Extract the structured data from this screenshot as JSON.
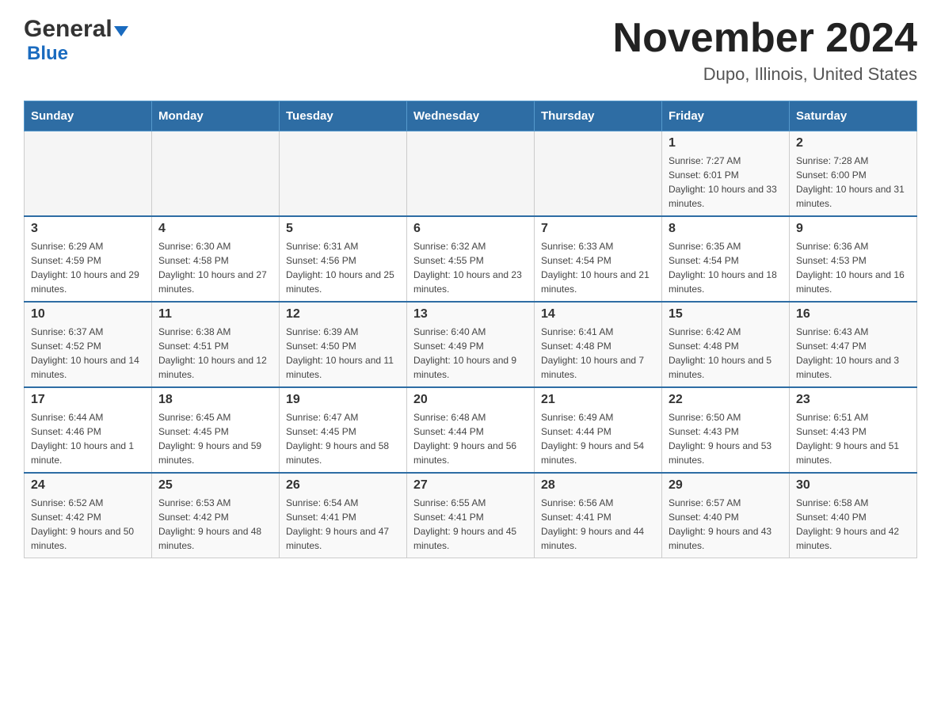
{
  "header": {
    "logo_general": "General",
    "logo_blue": "Blue",
    "title": "November 2024",
    "subtitle": "Dupo, Illinois, United States"
  },
  "days_of_week": [
    "Sunday",
    "Monday",
    "Tuesday",
    "Wednesday",
    "Thursday",
    "Friday",
    "Saturday"
  ],
  "weeks": [
    [
      {
        "day": "",
        "sunrise": "",
        "sunset": "",
        "daylight": ""
      },
      {
        "day": "",
        "sunrise": "",
        "sunset": "",
        "daylight": ""
      },
      {
        "day": "",
        "sunrise": "",
        "sunset": "",
        "daylight": ""
      },
      {
        "day": "",
        "sunrise": "",
        "sunset": "",
        "daylight": ""
      },
      {
        "day": "",
        "sunrise": "",
        "sunset": "",
        "daylight": ""
      },
      {
        "day": "1",
        "sunrise": "Sunrise: 7:27 AM",
        "sunset": "Sunset: 6:01 PM",
        "daylight": "Daylight: 10 hours and 33 minutes."
      },
      {
        "day": "2",
        "sunrise": "Sunrise: 7:28 AM",
        "sunset": "Sunset: 6:00 PM",
        "daylight": "Daylight: 10 hours and 31 minutes."
      }
    ],
    [
      {
        "day": "3",
        "sunrise": "Sunrise: 6:29 AM",
        "sunset": "Sunset: 4:59 PM",
        "daylight": "Daylight: 10 hours and 29 minutes."
      },
      {
        "day": "4",
        "sunrise": "Sunrise: 6:30 AM",
        "sunset": "Sunset: 4:58 PM",
        "daylight": "Daylight: 10 hours and 27 minutes."
      },
      {
        "day": "5",
        "sunrise": "Sunrise: 6:31 AM",
        "sunset": "Sunset: 4:56 PM",
        "daylight": "Daylight: 10 hours and 25 minutes."
      },
      {
        "day": "6",
        "sunrise": "Sunrise: 6:32 AM",
        "sunset": "Sunset: 4:55 PM",
        "daylight": "Daylight: 10 hours and 23 minutes."
      },
      {
        "day": "7",
        "sunrise": "Sunrise: 6:33 AM",
        "sunset": "Sunset: 4:54 PM",
        "daylight": "Daylight: 10 hours and 21 minutes."
      },
      {
        "day": "8",
        "sunrise": "Sunrise: 6:35 AM",
        "sunset": "Sunset: 4:54 PM",
        "daylight": "Daylight: 10 hours and 18 minutes."
      },
      {
        "day": "9",
        "sunrise": "Sunrise: 6:36 AM",
        "sunset": "Sunset: 4:53 PM",
        "daylight": "Daylight: 10 hours and 16 minutes."
      }
    ],
    [
      {
        "day": "10",
        "sunrise": "Sunrise: 6:37 AM",
        "sunset": "Sunset: 4:52 PM",
        "daylight": "Daylight: 10 hours and 14 minutes."
      },
      {
        "day": "11",
        "sunrise": "Sunrise: 6:38 AM",
        "sunset": "Sunset: 4:51 PM",
        "daylight": "Daylight: 10 hours and 12 minutes."
      },
      {
        "day": "12",
        "sunrise": "Sunrise: 6:39 AM",
        "sunset": "Sunset: 4:50 PM",
        "daylight": "Daylight: 10 hours and 11 minutes."
      },
      {
        "day": "13",
        "sunrise": "Sunrise: 6:40 AM",
        "sunset": "Sunset: 4:49 PM",
        "daylight": "Daylight: 10 hours and 9 minutes."
      },
      {
        "day": "14",
        "sunrise": "Sunrise: 6:41 AM",
        "sunset": "Sunset: 4:48 PM",
        "daylight": "Daylight: 10 hours and 7 minutes."
      },
      {
        "day": "15",
        "sunrise": "Sunrise: 6:42 AM",
        "sunset": "Sunset: 4:48 PM",
        "daylight": "Daylight: 10 hours and 5 minutes."
      },
      {
        "day": "16",
        "sunrise": "Sunrise: 6:43 AM",
        "sunset": "Sunset: 4:47 PM",
        "daylight": "Daylight: 10 hours and 3 minutes."
      }
    ],
    [
      {
        "day": "17",
        "sunrise": "Sunrise: 6:44 AM",
        "sunset": "Sunset: 4:46 PM",
        "daylight": "Daylight: 10 hours and 1 minute."
      },
      {
        "day": "18",
        "sunrise": "Sunrise: 6:45 AM",
        "sunset": "Sunset: 4:45 PM",
        "daylight": "Daylight: 9 hours and 59 minutes."
      },
      {
        "day": "19",
        "sunrise": "Sunrise: 6:47 AM",
        "sunset": "Sunset: 4:45 PM",
        "daylight": "Daylight: 9 hours and 58 minutes."
      },
      {
        "day": "20",
        "sunrise": "Sunrise: 6:48 AM",
        "sunset": "Sunset: 4:44 PM",
        "daylight": "Daylight: 9 hours and 56 minutes."
      },
      {
        "day": "21",
        "sunrise": "Sunrise: 6:49 AM",
        "sunset": "Sunset: 4:44 PM",
        "daylight": "Daylight: 9 hours and 54 minutes."
      },
      {
        "day": "22",
        "sunrise": "Sunrise: 6:50 AM",
        "sunset": "Sunset: 4:43 PM",
        "daylight": "Daylight: 9 hours and 53 minutes."
      },
      {
        "day": "23",
        "sunrise": "Sunrise: 6:51 AM",
        "sunset": "Sunset: 4:43 PM",
        "daylight": "Daylight: 9 hours and 51 minutes."
      }
    ],
    [
      {
        "day": "24",
        "sunrise": "Sunrise: 6:52 AM",
        "sunset": "Sunset: 4:42 PM",
        "daylight": "Daylight: 9 hours and 50 minutes."
      },
      {
        "day": "25",
        "sunrise": "Sunrise: 6:53 AM",
        "sunset": "Sunset: 4:42 PM",
        "daylight": "Daylight: 9 hours and 48 minutes."
      },
      {
        "day": "26",
        "sunrise": "Sunrise: 6:54 AM",
        "sunset": "Sunset: 4:41 PM",
        "daylight": "Daylight: 9 hours and 47 minutes."
      },
      {
        "day": "27",
        "sunrise": "Sunrise: 6:55 AM",
        "sunset": "Sunset: 4:41 PM",
        "daylight": "Daylight: 9 hours and 45 minutes."
      },
      {
        "day": "28",
        "sunrise": "Sunrise: 6:56 AM",
        "sunset": "Sunset: 4:41 PM",
        "daylight": "Daylight: 9 hours and 44 minutes."
      },
      {
        "day": "29",
        "sunrise": "Sunrise: 6:57 AM",
        "sunset": "Sunset: 4:40 PM",
        "daylight": "Daylight: 9 hours and 43 minutes."
      },
      {
        "day": "30",
        "sunrise": "Sunrise: 6:58 AM",
        "sunset": "Sunset: 4:40 PM",
        "daylight": "Daylight: 9 hours and 42 minutes."
      }
    ]
  ]
}
